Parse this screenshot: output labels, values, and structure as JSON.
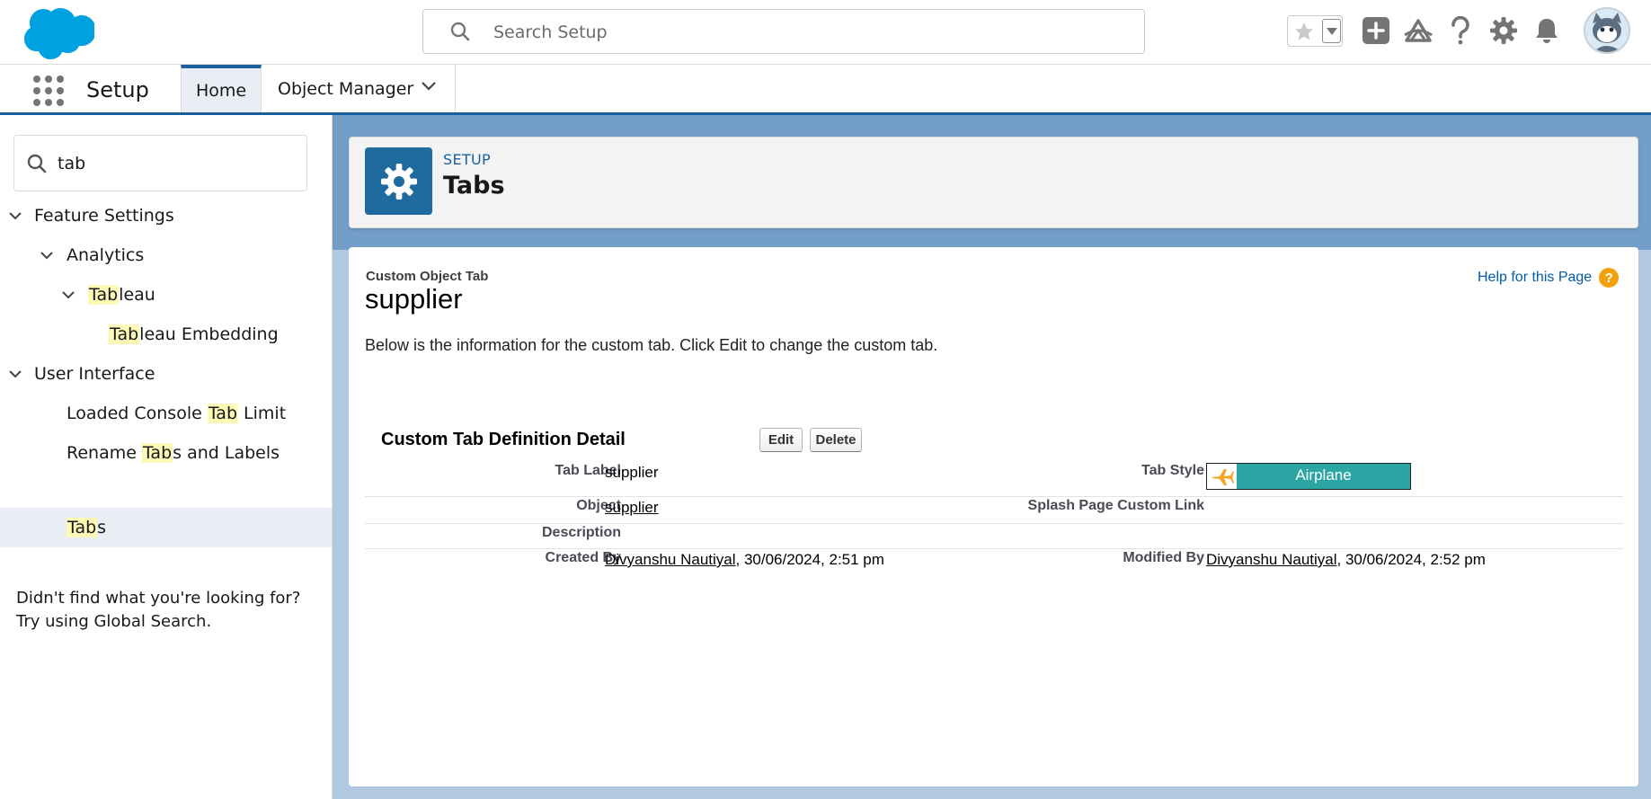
{
  "header": {
    "search_placeholder": "Search Setup",
    "icons": [
      "favorites-star-icon",
      "favorites-dropdown-icon",
      "global-actions-icon",
      "trailhead-icon",
      "help-icon",
      "setup-gear-icon",
      "notifications-bell-icon",
      "user-avatar"
    ]
  },
  "context_bar": {
    "app_name": "Setup",
    "tabs": [
      {
        "label": "Home",
        "active": true
      },
      {
        "label": "Object Manager",
        "active": false
      }
    ]
  },
  "sidebar": {
    "quick_find_value": "tab",
    "items": [
      {
        "label": "Feature Settings",
        "expanded": true
      },
      {
        "label": "Analytics",
        "expanded": true
      },
      {
        "label_pre": "",
        "label_hit": "Tab",
        "label_post": "leau",
        "expanded": true
      },
      {
        "label_pre": "",
        "label_hit": "Tab",
        "label_post": "leau Embedding"
      },
      {
        "label": "User Interface",
        "expanded": true
      },
      {
        "label_pre": "Loaded Console ",
        "label_hit": "Tab",
        "label_post": " Limit"
      },
      {
        "label_pre": "Rename ",
        "label_hit": "Tab",
        "label_post": "s and Labels"
      },
      {
        "label_pre": "",
        "label_hit": "Tab",
        "label_post": "s",
        "selected": true
      }
    ],
    "not_found_line1": "Didn't find what you're looking for?",
    "not_found_line2": "Try using Global Search."
  },
  "page_header": {
    "eyebrow": "SETUP",
    "title": "Tabs"
  },
  "content": {
    "eyebrow": "Custom Object Tab",
    "title": "supplier",
    "help_link": "Help for this Page",
    "description": "Below is the information for the custom tab. Click Edit to change the custom tab.",
    "section_title": "Custom Tab Definition Detail",
    "edit_label": "Edit",
    "delete_label": "Delete",
    "fields": {
      "tab_label": {
        "label": "Tab Label",
        "value": "supplier"
      },
      "tab_style": {
        "label": "Tab Style",
        "value": "Airplane",
        "color": "#2ba6a4"
      },
      "object": {
        "label": "Object",
        "value": "supplier"
      },
      "splash": {
        "label": "Splash Page Custom Link",
        "value": ""
      },
      "description": {
        "label": "Description",
        "value": ""
      },
      "created_by": {
        "label": "Created By",
        "user": "Divyanshu Nautiyal",
        "date": ", 30/06/2024, 2:51 pm"
      },
      "modified_by": {
        "label": "Modified By",
        "user": "Divyanshu Nautiyal",
        "date": ", 30/06/2024, 2:52 pm"
      }
    }
  },
  "colors": {
    "brand": "#1b5f9e",
    "highlight": "#fdf8b6",
    "setup_icon_bg": "#1f6a9e",
    "help_badge": "#f2a10d"
  }
}
